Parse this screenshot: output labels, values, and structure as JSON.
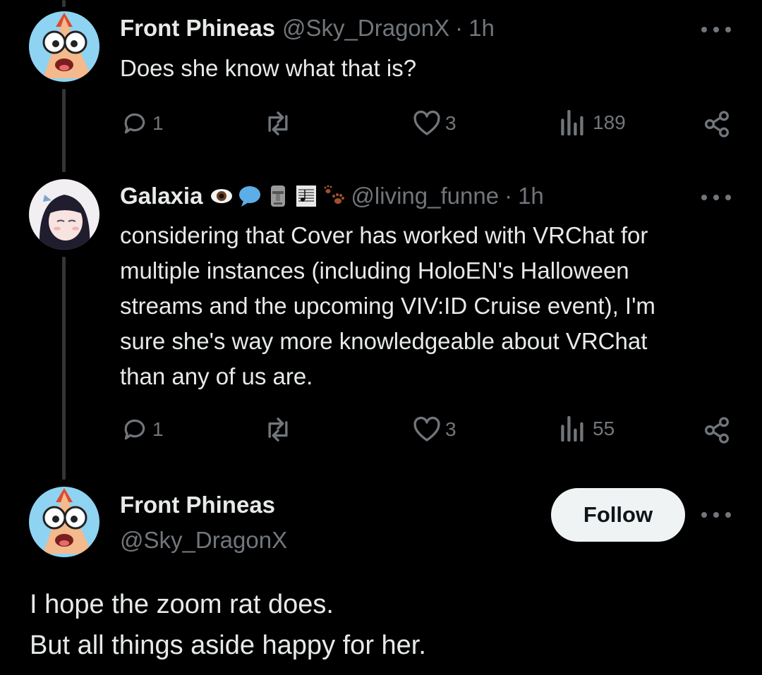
{
  "tweets": [
    {
      "name": "Front Phineas",
      "handle": "@Sky_DragonX",
      "separator": "·",
      "time": "1h",
      "text": [
        "Does she know what that is?"
      ],
      "replies": "1",
      "likes": "3",
      "views": "189"
    },
    {
      "name": "Galaxia",
      "emojis": [
        "eye-emoji",
        "speech-bubble-emoji",
        "moai-emoji",
        "sheet-music-emoji",
        "paw-prints-emoji"
      ],
      "handle": "@living_funne",
      "separator": "·",
      "time": "1h",
      "text": [
        "considering that Cover has worked with VRChat for",
        "multiple instances (including HoloEN's Halloween",
        "streams and the upcoming VIV:ID Cruise event), I'm",
        "sure she's way more knowledgeable about VRChat",
        "than any of us are."
      ],
      "replies": "1",
      "likes": "3",
      "views": "55"
    }
  ],
  "focused": {
    "name": "Front Phineas",
    "handle": "@Sky_DragonX",
    "follow_label": "Follow",
    "text": [
      "I hope the zoom rat does.",
      "But all things aside happy for her."
    ]
  },
  "colors": {
    "background": "#000000",
    "text": "#e7e9ea",
    "muted": "#71767b",
    "button": "#eff3f4"
  }
}
